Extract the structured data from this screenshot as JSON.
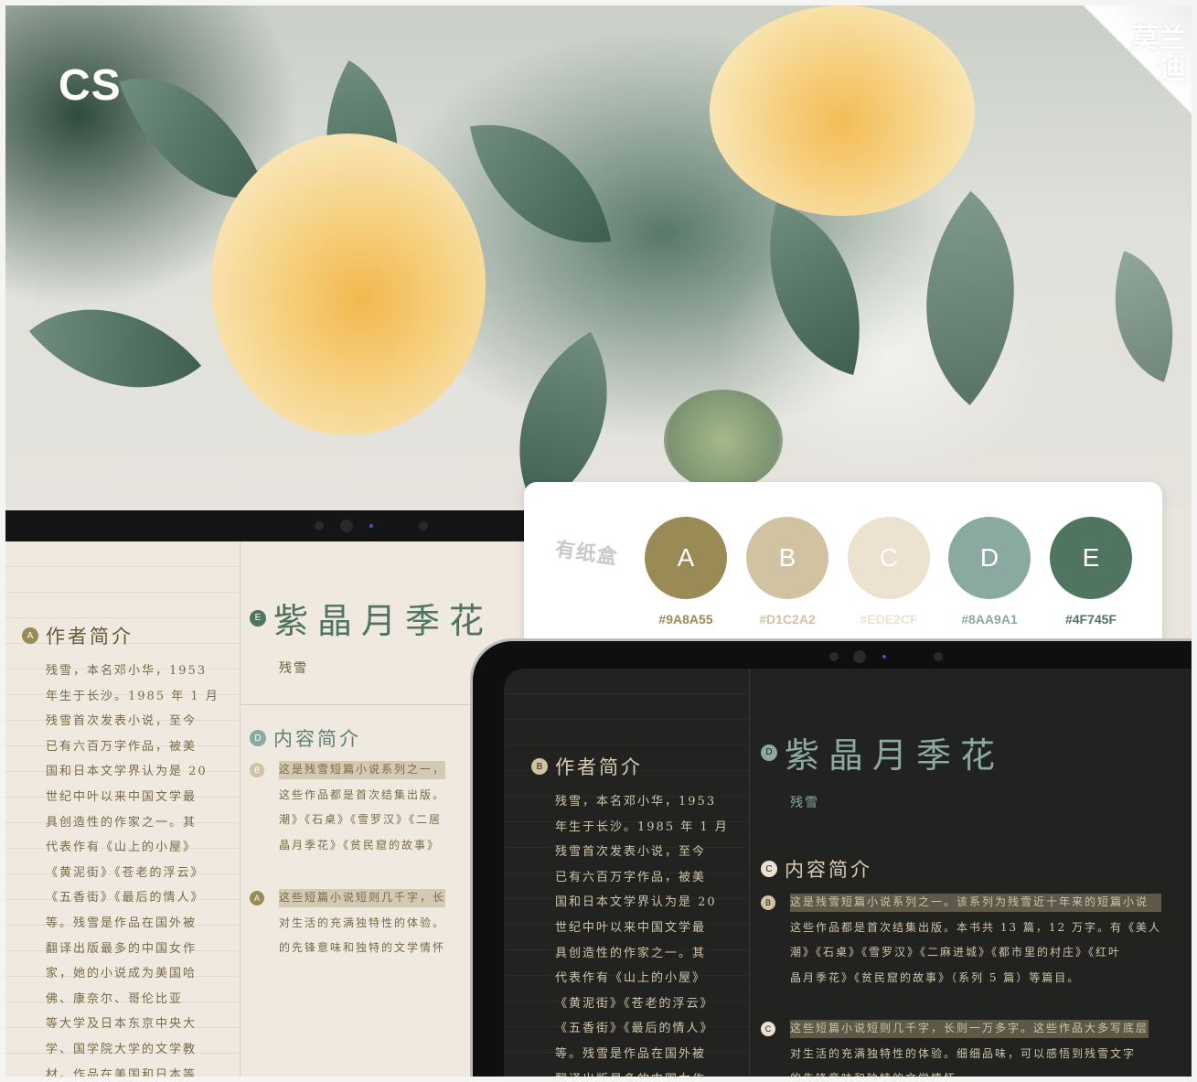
{
  "hero": {
    "logo": "CS",
    "brand": "莫兰迪"
  },
  "palette": {
    "logo": "有纸盒",
    "swatches": [
      {
        "letter": "A",
        "hex": "#9A8A55",
        "color": "#9A8A55"
      },
      {
        "letter": "B",
        "hex": "#D1C2A2",
        "color": "#D1C2A2"
      },
      {
        "letter": "C",
        "hex": "#EDE2CF",
        "color": "#EDE2CF"
      },
      {
        "letter": "D",
        "hex": "#8AA9A1",
        "color": "#8AA9A1"
      },
      {
        "letter": "E",
        "hex": "#4F745F",
        "color": "#4F745F"
      }
    ]
  },
  "light_tablet": {
    "author_badge": "A",
    "author_title": "作者简介",
    "author_lines": [
      "残雪，本名邓小华，1953",
      "年生于长沙。1985 年 1 月",
      "残雪首次发表小说，至今",
      "已有六百万字作品，被美",
      "国和日本文学界认为是 20",
      "世纪中叶以来中国文学最",
      "具创造性的作家之一。其",
      "代表作有《山上的小屋》",
      "《黄泥街》《苍老的浮云》",
      "《五香街》《最后的情人》",
      "等。残雪是作品在国外被",
      "翻译出版最多的中国女作",
      "家，她的小说成为美国哈",
      "佛、康奈尔、哥伦比亚",
      "等大学及日本东京中央大",
      "学、国学院大学的文学教",
      "材。作品在美国和日本等"
    ],
    "book_badge": "E",
    "book_title": "紫晶月季花",
    "book_author": "残雪",
    "content_badge": "D",
    "content_title": "内容简介",
    "para1_badge": "B",
    "para1_lines": [
      "这是残雪短篇小说系列之一，",
      "这些作品都是首次结集出版。",
      "潮》《石桌》《雪罗汉》《二居",
      "晶月季花》《贫民窟的故事》"
    ],
    "para2_badge": "A",
    "para2_lines": [
      "这些短篇小说短则几千字，长",
      "对生活的充满独特性的体验。",
      "的先锋意味和独特的文学情怀"
    ]
  },
  "dark_tablet": {
    "author_badge": "B",
    "author_title": "作者简介",
    "author_lines": [
      "残雪，本名邓小华，1953",
      "年生于长沙。1985 年 1 月",
      "残雪首次发表小说，至今",
      "已有六百万字作品，被美",
      "国和日本文学界认为是 20",
      "世纪中叶以来中国文学最",
      "具创造性的作家之一。其",
      "代表作有《山上的小屋》",
      "《黄泥街》《苍老的浮云》",
      "《五香街》《最后的情人》",
      "等。残雪是作品在国外被",
      "翻译出版最多的中国女作"
    ],
    "book_badge": "D",
    "book_title": "紫晶月季花",
    "book_author": "残雪",
    "content_badge": "C",
    "content_title": "内容简介",
    "para1_badge": "B",
    "para1_lines": [
      "这是残雪短篇小说系列之一。该系列为残雪近十年来的短篇小说",
      "这些作品都是首次结集出版。本书共 13 篇，12 万字。有《美人",
      "潮》《石桌》《雪罗汉》《二麻进城》《都市里的村庄》《红叶",
      "晶月季花》《贫民窟的故事》（系列 5 篇）等篇目。"
    ],
    "para2_badge": "C",
    "para2_lines": [
      "这些短篇小说短则几千字，长则一万多字。这些作品大多写底层",
      "对生活的充满独特性的体验。细细品味，可以感悟到残雪文字",
      "的先锋意味和独特的文学情怀。"
    ]
  }
}
